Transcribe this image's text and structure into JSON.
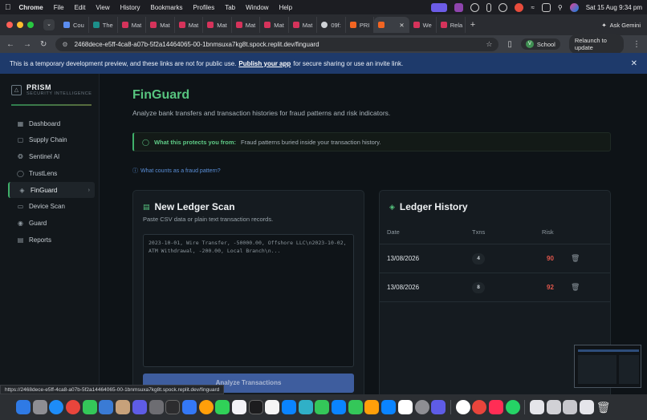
{
  "menubar": {
    "app": "Chrome",
    "items": [
      "File",
      "Edit",
      "View",
      "History",
      "Bookmarks",
      "Profiles",
      "Tab",
      "Window",
      "Help"
    ],
    "datetime": "Sat 15 Aug  9:34 pm"
  },
  "tabs": [
    {
      "label": "Cou",
      "color": "#5b8def"
    },
    {
      "label": "The",
      "color": "#1c8f8a"
    },
    {
      "label": "Mat",
      "color": "#d6335b"
    },
    {
      "label": "Mat",
      "color": "#d6335b"
    },
    {
      "label": "Mat",
      "color": "#d6335b"
    },
    {
      "label": "Mat",
      "color": "#d6335b"
    },
    {
      "label": "Mat",
      "color": "#d6335b"
    },
    {
      "label": "Mat",
      "color": "#d6335b"
    },
    {
      "label": "Mat",
      "color": "#d6335b"
    },
    {
      "label": "09f:",
      "color": "#cfd2d6"
    },
    {
      "label": "PRI",
      "color": "#f26522"
    },
    {
      "label": "",
      "color": "#f26522"
    },
    {
      "label": "We",
      "color": "#d6335b"
    },
    {
      "label": "Rela",
      "color": "#d6335b"
    }
  ],
  "ask_gemini": "Ask Gemini",
  "address": {
    "url": "2468dece-e5ff-4ca8-a07b-5f2a14464065-00-1bnmsuxa7kg8t.spock.replit.dev/finguard",
    "profile_initial": "V",
    "profile_name": "School",
    "relaunch": "Relaunch to update"
  },
  "banner": {
    "text_before": "This is a temporary development preview, and these links are not for public use.",
    "link": "Publish your app",
    "text_after": "for secure sharing or use an invite link."
  },
  "sidebar": {
    "brand": "PRISM",
    "brand_sub": "SECURITY INTELLIGENCE",
    "items": [
      {
        "label": "Dashboard",
        "icon": "grid-icon"
      },
      {
        "label": "Supply Chain",
        "icon": "box-icon"
      },
      {
        "label": "Sentinel AI",
        "icon": "brain-icon"
      },
      {
        "label": "TrustLens",
        "icon": "lens-icon"
      },
      {
        "label": "FinGuard",
        "icon": "shield-icon",
        "active": true
      },
      {
        "label": "Device Scan",
        "icon": "device-icon"
      },
      {
        "label": "Guard",
        "icon": "lock-icon"
      },
      {
        "label": "Reports",
        "icon": "report-icon"
      }
    ]
  },
  "page": {
    "title": "FinGuard",
    "subtitle": "Analyze bank transfers and transaction histories for fraud patterns and risk indicators.",
    "protect_label": "What this protects you from:",
    "protect_text": "Fraud patterns buried inside your transaction history.",
    "fraud_link": "What counts as a fraud pattern?"
  },
  "scan": {
    "title": "New Ledger Scan",
    "subtitle": "Paste CSV data or plain text transaction records.",
    "placeholder": "2023-10-01, Wire Transfer, -50000.00, Offshore LLC\\n2023-10-02, ATM Withdrawal, -200.00, Local Branch\\n...",
    "button": "Analyze Transactions"
  },
  "history": {
    "title": "Ledger History",
    "columns": [
      "Date",
      "Txns",
      "Risk"
    ],
    "rows": [
      {
        "date": "13/08/2026",
        "txns": "4",
        "risk": "90"
      },
      {
        "date": "13/08/2026",
        "txns": "8",
        "risk": "92"
      }
    ]
  },
  "status_url": "https://2468dece-e5ff-4ca8-a07b-5f2a14464065-00-1bnmsuxa7kg8t.spock.replit.dev/finguard",
  "colors": {
    "accent": "#57c47f",
    "risk": "#e2574c",
    "banner": "#1e3a6b"
  }
}
